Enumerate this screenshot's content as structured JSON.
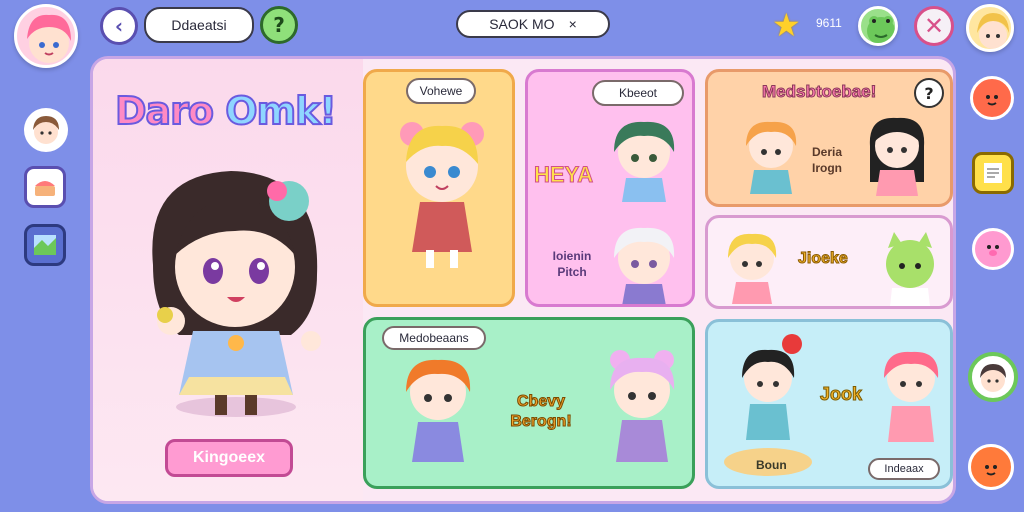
{
  "topbar": {
    "search_label": "Ddaeatsi",
    "mode_label": "SAOK MO",
    "close_mark": "×",
    "coins": "9611",
    "help_mark": "?",
    "back_mark": "‹",
    "exit_mark": "✕"
  },
  "panel": {
    "title_part1": "Daro",
    "title_part2": "Omk!",
    "main_button": "Kingoeex"
  },
  "cards": {
    "card1_label": "Vohewe",
    "card2_label": "Kbeeot",
    "card2_text_big": "HEYA",
    "card2_text_small": "Ioienin Pitch",
    "card3_title": "Medsbtoebae!",
    "card3_help": "?",
    "card3_text": "Deria Irogn",
    "card4_text": "Jioeke",
    "card5_label": "Medobeaans",
    "card5_text": "Cbevy Berogn!",
    "card6_text": "Jook",
    "card6_bottom_left": "Boun",
    "card6_bottom_right": "Indeaax"
  }
}
